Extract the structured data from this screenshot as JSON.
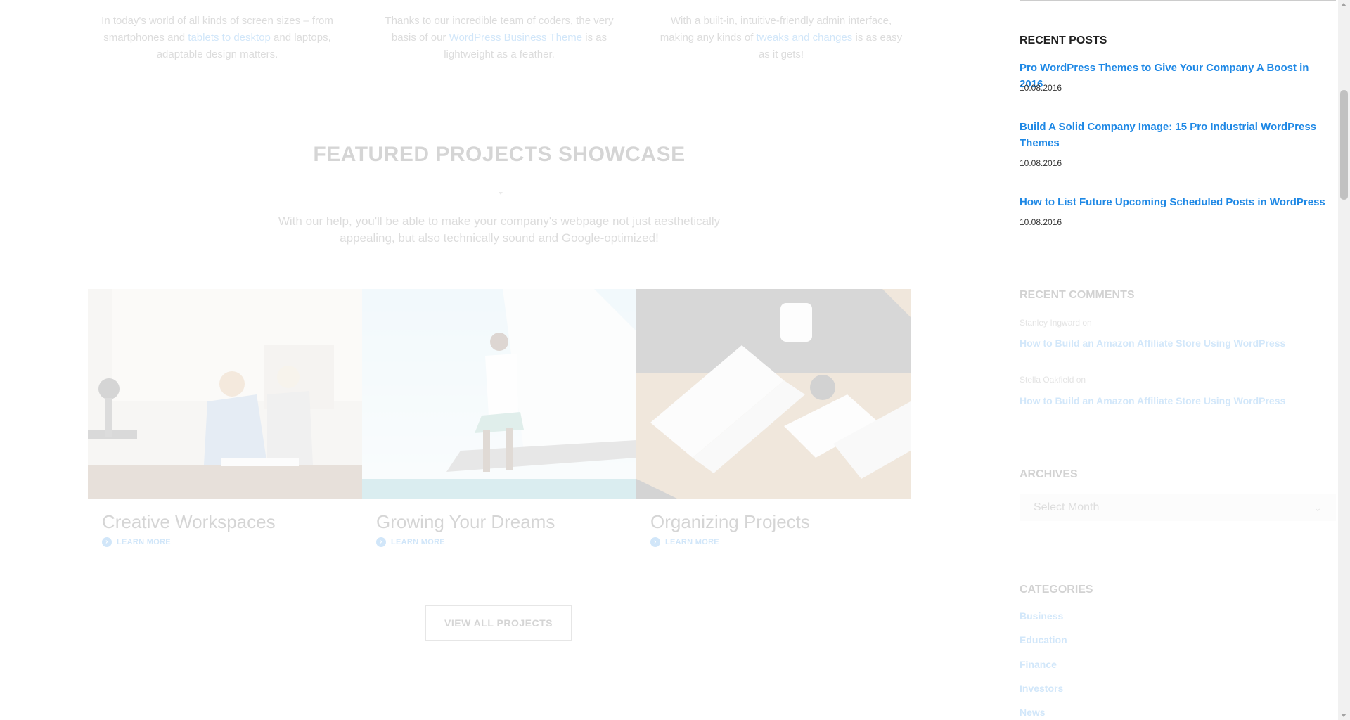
{
  "features": [
    {
      "pre": "In today's world of all kinds of screen sizes – from smartphones and ",
      "link": "tablets to desktop",
      "post": " and laptops, adaptable design matters."
    },
    {
      "pre": "Thanks to our incredible team of coders, the very basis of our ",
      "link": "WordPress Business Theme",
      "post": " is as lightweight as a feather."
    },
    {
      "pre": "With a built-in, intuitive-friendly admin interface, making any kinds of ",
      "link": "tweaks and changes",
      "post": " is as easy as it gets!"
    }
  ],
  "showcase": {
    "title": "FEATURED PROJECTS SHOWCASE",
    "intro": "With our help, you'll be able to make your company's webpage not just aesthetically appealing, but also technically sound and Google-optimized!",
    "projects": [
      {
        "title": "Creative Workspaces",
        "link": "LEARN MORE"
      },
      {
        "title": "Growing Your Dreams",
        "link": "LEARN MORE"
      },
      {
        "title": "Organizing Projects",
        "link": "LEARN MORE"
      }
    ],
    "view_all": "VIEW ALL PROJECTS"
  },
  "sidebar": {
    "recent_posts": {
      "title": "RECENT POSTS",
      "items": [
        {
          "title": "Pro WordPress Themes to Give Your Company A Boost in 2016",
          "date": "10.08.2016"
        },
        {
          "title": "Build A Solid Company Image: 15 Pro Industrial WordPress Themes",
          "date": "10.08.2016"
        },
        {
          "title": "How to List Future Upcoming Scheduled Posts in WordPress",
          "date": "10.08.2016"
        }
      ]
    },
    "recent_comments": {
      "title": "RECENT COMMENTS",
      "items": [
        {
          "author": "Stanley Ingward on",
          "post": "How to Build an Amazon Affiliate Store Using WordPress"
        },
        {
          "author": "Stella Oakfield on",
          "post": "How to Build an Amazon Affiliate Store Using WordPress"
        }
      ]
    },
    "archives": {
      "title": "ARCHIVES",
      "select_value": "Select Month"
    },
    "categories": {
      "title": "CATEGORIES",
      "items": [
        "Business",
        "Education",
        "Finance",
        "Investors",
        "News"
      ]
    }
  },
  "colors": {
    "accent": "#1e88e5",
    "text": "#333333"
  }
}
